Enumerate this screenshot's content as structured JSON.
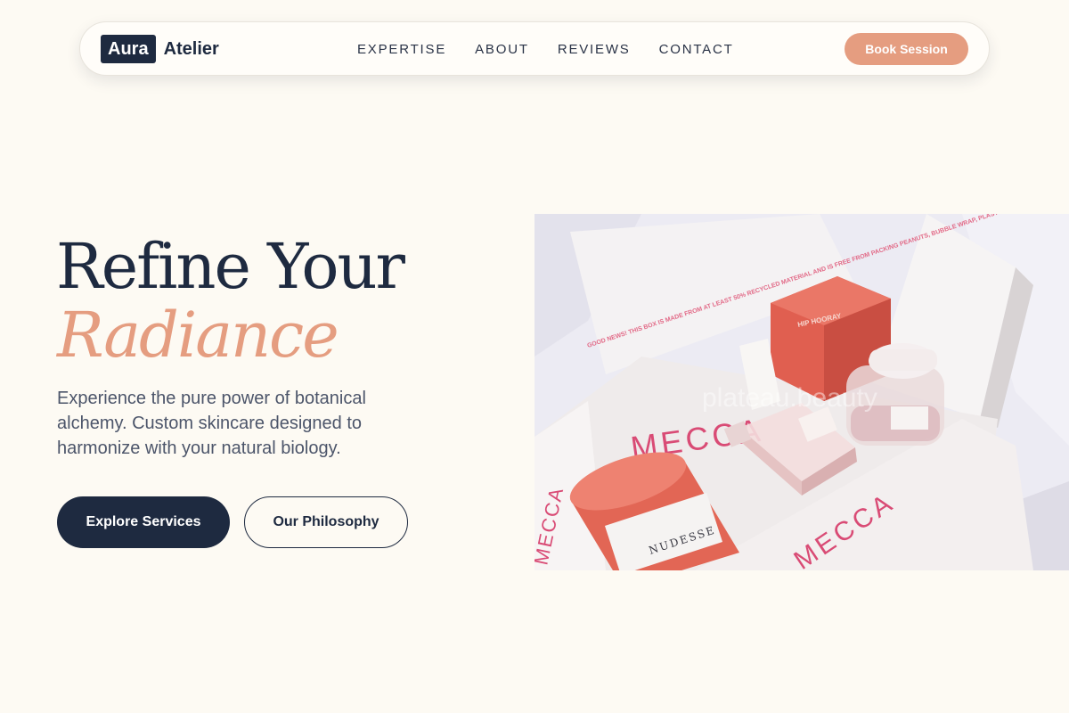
{
  "brand": {
    "logo_box": "Aura",
    "logo_word": "Atelier"
  },
  "nav": {
    "links": [
      "EXPERTISE",
      "ABOUT",
      "REVIEWS",
      "CONTACT"
    ],
    "cta": "Book Session"
  },
  "hero": {
    "title_line1": "Refine Your",
    "title_line2": "Radiance",
    "description": "Experience the pure power of botanical alchemy. Custom skincare designed to harmonize with your natural biology.",
    "primary_button": "Explore Services",
    "secondary_button": "Our Philosophy"
  },
  "image": {
    "watermark": "plateau.beauty",
    "box_brand": "MECCA",
    "jar_label": "NUDESSE",
    "box_label": "HIP HOORAY",
    "box_print": "GOOD NEWS! THIS BOX IS MADE FROM AT LEAST 50% RECYCLED MATERIAL AND IS FREE FROM PACKING PEANUTS, BUBBLE WRAP, PLASTIC BAGS, POLYSTYRENE FOAM AND OTHER UNNECESSARY FILLER."
  },
  "colors": {
    "navy": "#1e2a40",
    "accent": "#e59d80",
    "background": "#fdfaf3",
    "product_red": "#e26655"
  }
}
